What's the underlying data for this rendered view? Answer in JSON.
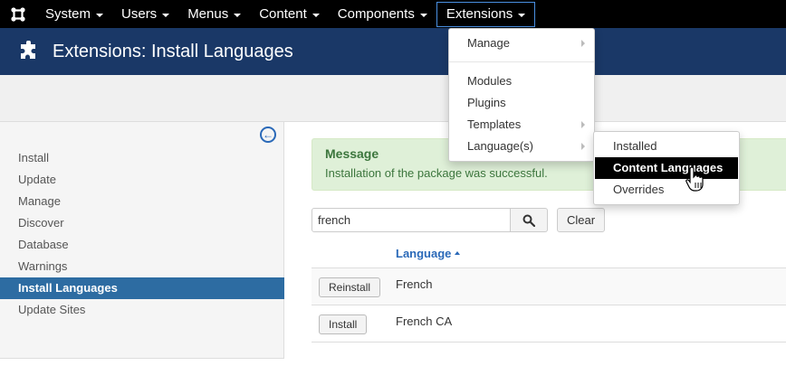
{
  "navbar": {
    "logo": "joomla-icon",
    "items": [
      {
        "label": "System"
      },
      {
        "label": "Users"
      },
      {
        "label": "Menus"
      },
      {
        "label": "Content"
      },
      {
        "label": "Components"
      },
      {
        "label": "Extensions"
      }
    ]
  },
  "header": {
    "icon": "puzzle-icon",
    "title": "Extensions: Install Languages"
  },
  "sidebar": {
    "toggle_icon": "collapse-left-icon",
    "items": [
      {
        "label": "Install"
      },
      {
        "label": "Update"
      },
      {
        "label": "Manage"
      },
      {
        "label": "Discover"
      },
      {
        "label": "Database"
      },
      {
        "label": "Warnings"
      },
      {
        "label": "Install Languages"
      },
      {
        "label": "Update Sites"
      }
    ]
  },
  "message": {
    "title": "Message",
    "text": "Installation of the package was successful."
  },
  "search": {
    "value": "french",
    "clear_label": "Clear"
  },
  "table": {
    "column_language": "Language",
    "rows": [
      {
        "action": "Reinstall",
        "name": "French"
      },
      {
        "action": "Install",
        "name": "French CA"
      }
    ]
  },
  "extensions_menu": {
    "items": [
      {
        "label": "Manage"
      },
      {
        "label": "Modules"
      },
      {
        "label": "Plugins"
      },
      {
        "label": "Templates"
      },
      {
        "label": "Language(s)"
      }
    ]
  },
  "languages_submenu": {
    "items": [
      {
        "label": "Installed"
      },
      {
        "label": "Content Languages"
      },
      {
        "label": "Overrides"
      }
    ]
  },
  "colors": {
    "navbar": "#000000",
    "header": "#1a3867",
    "sidebar_active": "#2d6ca2",
    "link": "#2a69b8",
    "success_bg": "#dff0d8",
    "success_text": "#3c763d"
  }
}
